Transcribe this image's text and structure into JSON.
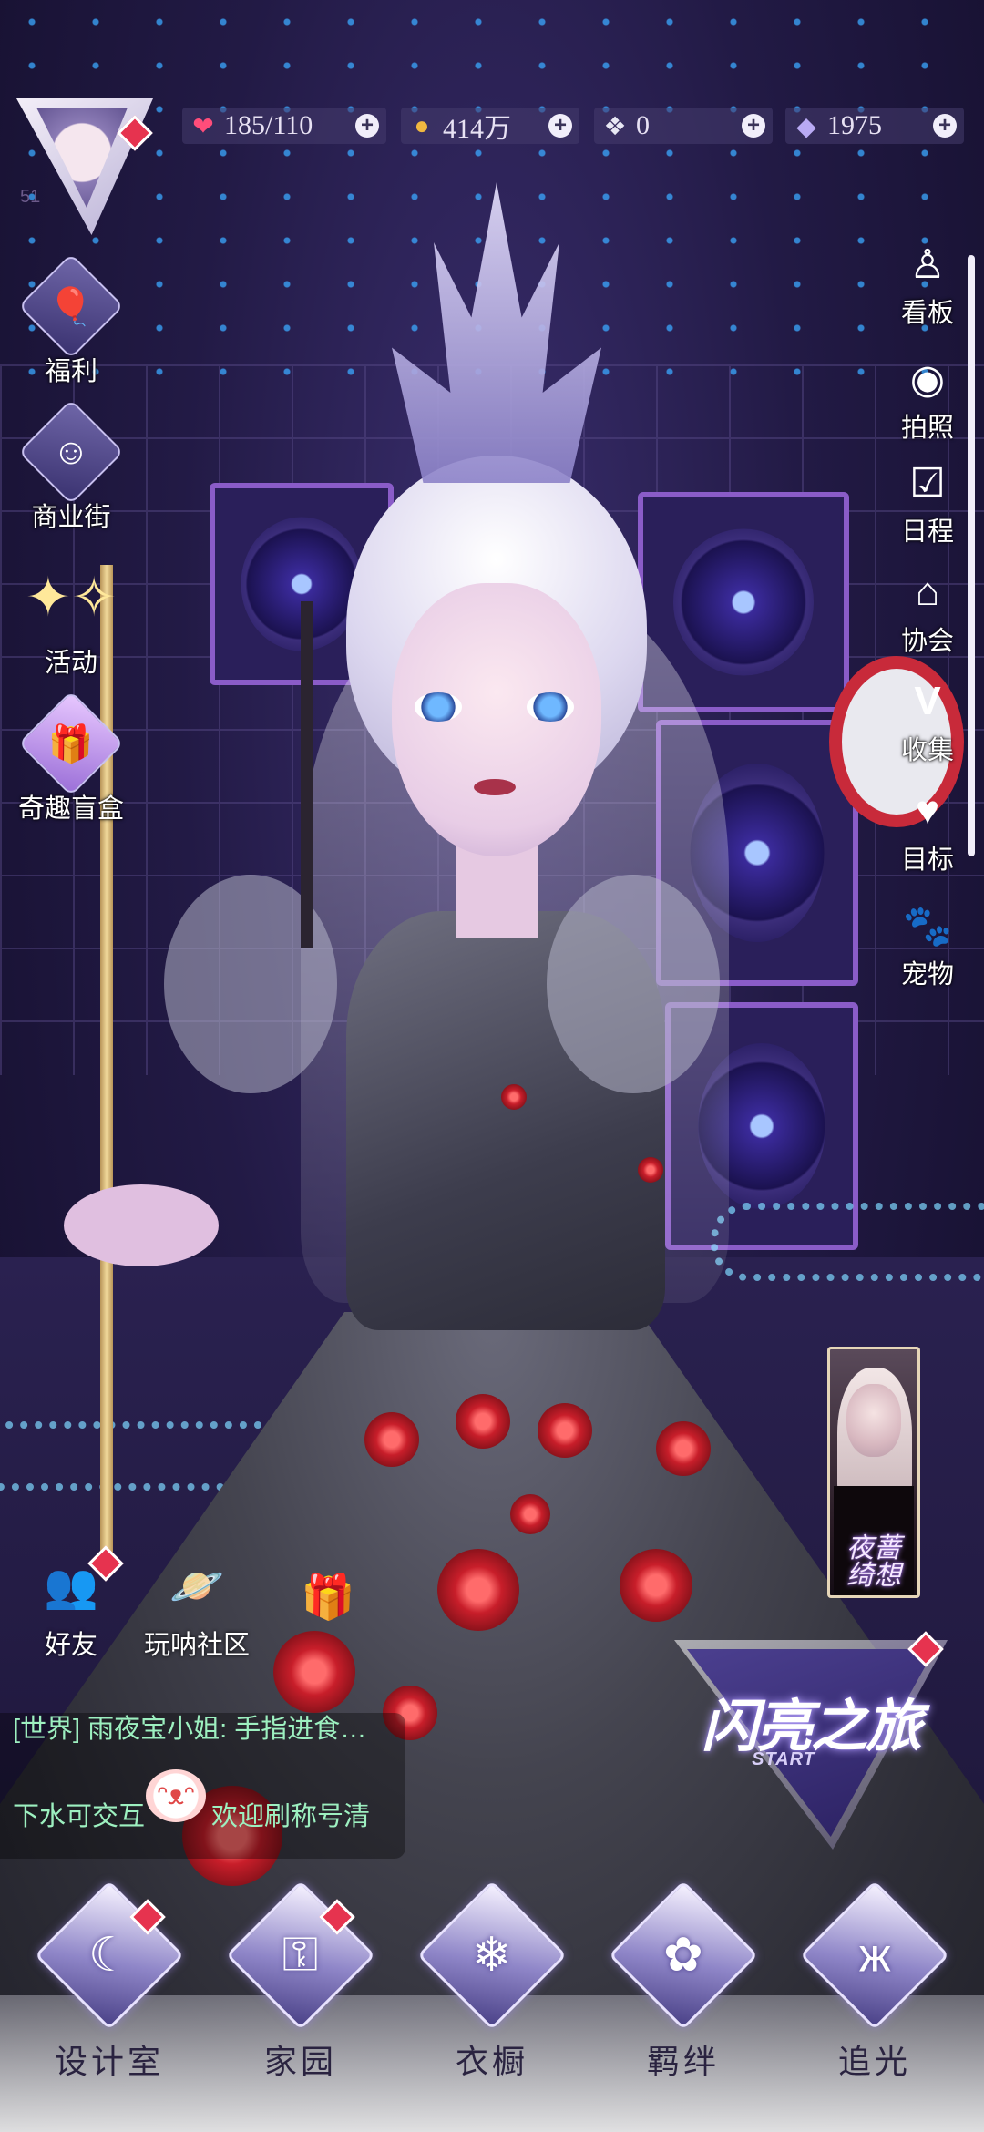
{
  "player": {
    "level": "51"
  },
  "resources": [
    {
      "name": "stamina",
      "icon": "heart-gem-icon",
      "value": "185/110"
    },
    {
      "name": "coins",
      "icon": "gold-coin-icon",
      "value": "414万"
    },
    {
      "name": "crystal",
      "icon": "white-crystal-icon",
      "value": "0"
    },
    {
      "name": "diamonds",
      "icon": "diamond-icon",
      "value": "1975"
    }
  ],
  "left_menu": [
    {
      "label": "福利",
      "icon": "hot-air-balloon-icon"
    },
    {
      "label": "商业街",
      "icon": "shopping-bag-icon"
    },
    {
      "label": "活动",
      "icon": "stars-icon"
    },
    {
      "label": "奇趣盲盒",
      "icon": "gift-box-icon"
    }
  ],
  "right_menu": [
    {
      "label": "看板",
      "icon": "mannequin-icon"
    },
    {
      "label": "拍照",
      "icon": "camera-icon"
    },
    {
      "label": "日程",
      "icon": "calendar-check-icon"
    },
    {
      "label": "协会",
      "icon": "guild-building-icon"
    },
    {
      "label": "收集",
      "icon": "v-badge-icon"
    },
    {
      "label": "目标",
      "icon": "heart-medal-icon"
    },
    {
      "label": "宠物",
      "icon": "paw-icon"
    }
  ],
  "promo": {
    "title": "夜蔷绮想"
  },
  "social": [
    {
      "label": "好友",
      "icon": "friends-icon"
    },
    {
      "label": "玩呐社区",
      "icon": "planet-heart-icon"
    }
  ],
  "chat": {
    "line1": "[世界] 雨夜宝小姐: 手指进食…",
    "line2_a": "下水可交互",
    "line2_b": "欢迎刷称号清"
  },
  "start_journey": {
    "title": "闪亮之旅",
    "subtitle": "START"
  },
  "bottom_nav": [
    {
      "label": "设计室",
      "icon": "crescent-moon-icon"
    },
    {
      "label": "家园",
      "icon": "key-icon"
    },
    {
      "label": "衣橱",
      "icon": "snowflake-icon"
    },
    {
      "label": "羁绊",
      "icon": "clover-icon"
    },
    {
      "label": "追光",
      "icon": "butterfly-icon"
    }
  ],
  "colors": {
    "accent": "#e6334f",
    "nav_text": "#2a2340",
    "chat_text": "#9df0c0"
  }
}
